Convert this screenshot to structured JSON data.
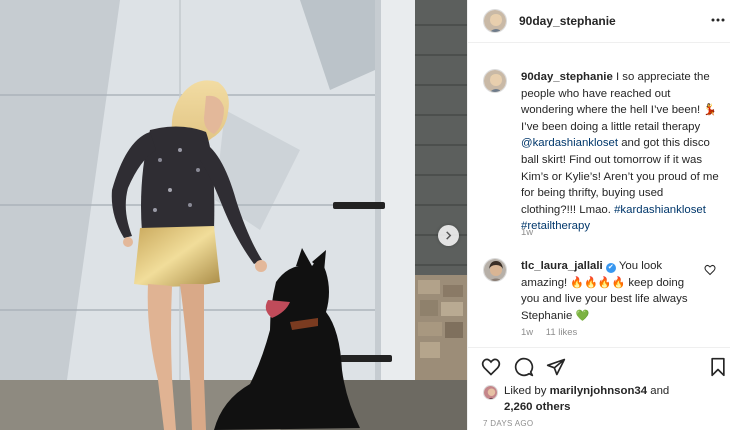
{
  "post": {
    "username": "90day_stephanie",
    "caption": {
      "username": "90day_stephanie",
      "text_1": " I so appreciate the people who have reached out wondering where the hell I’ve been! ",
      "emoji_1": "💃",
      "text_2": " I’ve been doing a little retail therapy ",
      "mention": "@kardashiankloset",
      "text_3": " and got this disco ball skirt! Find out tomorrow if it was Kim’s or Kylie’s! Aren’t you proud of me for being thrifty, buying used clothing?!!! Lmao. ",
      "hashtag_1": "#kardashiankloset",
      "hashtag_2": "#retailtherapy",
      "time": "1w"
    },
    "comment": {
      "username": "tlc_laura_jallali",
      "verified_mark": "✔",
      "text_1": " You look amazing! ",
      "emoji_fire": "🔥🔥🔥🔥",
      "text_2": " keep doing you and live your best life always Stephanie ",
      "emoji_heart": "💚",
      "time": "1w",
      "likes": "11 likes"
    },
    "likes": {
      "prefix": "Liked by ",
      "user": "marilynjohnson34",
      "middle": " and",
      "count": "2,260 others"
    },
    "posted": "7 DAYS AGO"
  },
  "icons": {
    "more": "more-options-icon",
    "next": "chevron-right-icon",
    "heart": "heart-icon",
    "comment": "comment-icon",
    "share": "share-icon",
    "save": "bookmark-icon"
  },
  "colors": {
    "link": "#00376b",
    "muted": "#8e8e8e",
    "verified": "#3897f0"
  }
}
